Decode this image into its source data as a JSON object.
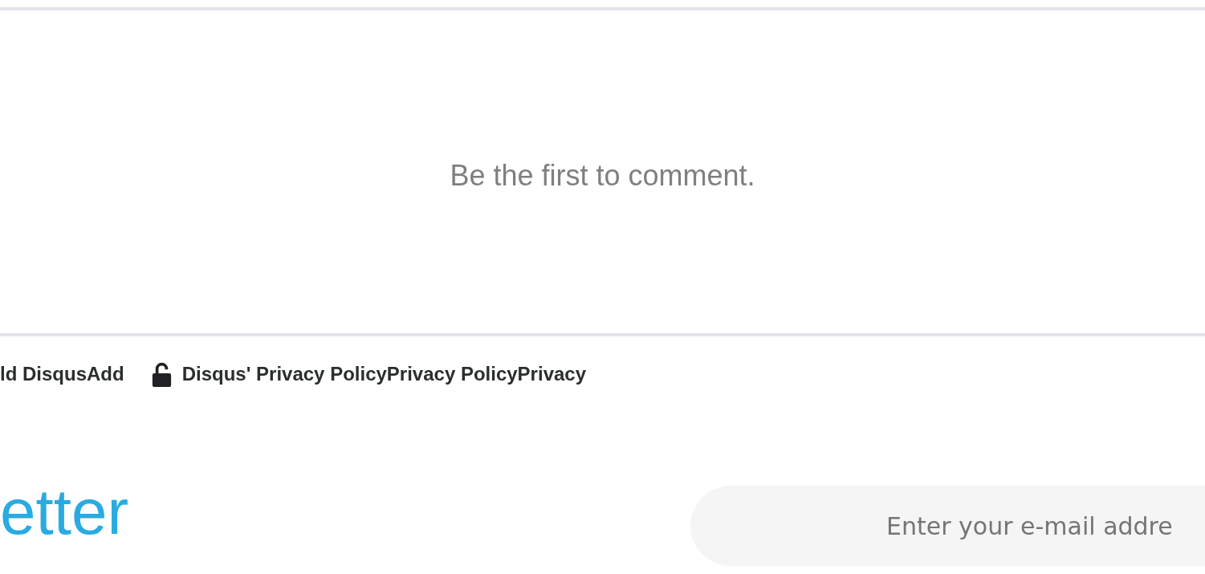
{
  "comments": {
    "empty_message": "Be the first to comment."
  },
  "footer_links": [
    {
      "kind": "text",
      "label": "ld DisqusAdd"
    },
    {
      "kind": "lock",
      "label": "Disqus' Privacy PolicyPrivacy PolicyPrivacy"
    }
  ],
  "newsletter": {
    "title": "etter",
    "email_field": {
      "placeholder": "Enter your e-mail addre"
    }
  }
}
